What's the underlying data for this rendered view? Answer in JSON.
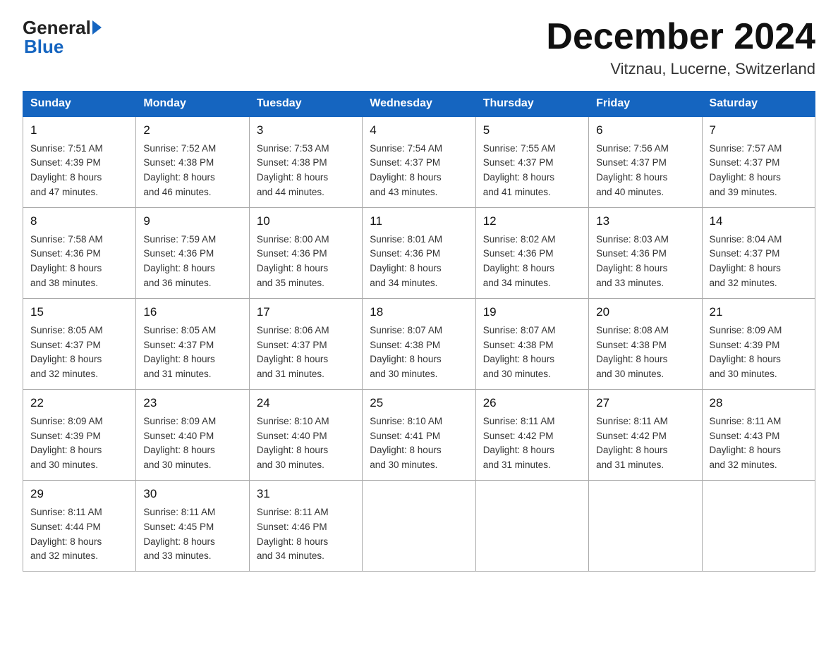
{
  "header": {
    "logo_general": "General",
    "logo_blue": "Blue",
    "month_title": "December 2024",
    "location": "Vitznau, Lucerne, Switzerland"
  },
  "days_of_week": [
    "Sunday",
    "Monday",
    "Tuesday",
    "Wednesday",
    "Thursday",
    "Friday",
    "Saturday"
  ],
  "weeks": [
    [
      {
        "day": "1",
        "sunrise": "7:51 AM",
        "sunset": "4:39 PM",
        "daylight": "8 hours and 47 minutes."
      },
      {
        "day": "2",
        "sunrise": "7:52 AM",
        "sunset": "4:38 PM",
        "daylight": "8 hours and 46 minutes."
      },
      {
        "day": "3",
        "sunrise": "7:53 AM",
        "sunset": "4:38 PM",
        "daylight": "8 hours and 44 minutes."
      },
      {
        "day": "4",
        "sunrise": "7:54 AM",
        "sunset": "4:37 PM",
        "daylight": "8 hours and 43 minutes."
      },
      {
        "day": "5",
        "sunrise": "7:55 AM",
        "sunset": "4:37 PM",
        "daylight": "8 hours and 41 minutes."
      },
      {
        "day": "6",
        "sunrise": "7:56 AM",
        "sunset": "4:37 PM",
        "daylight": "8 hours and 40 minutes."
      },
      {
        "day": "7",
        "sunrise": "7:57 AM",
        "sunset": "4:37 PM",
        "daylight": "8 hours and 39 minutes."
      }
    ],
    [
      {
        "day": "8",
        "sunrise": "7:58 AM",
        "sunset": "4:36 PM",
        "daylight": "8 hours and 38 minutes."
      },
      {
        "day": "9",
        "sunrise": "7:59 AM",
        "sunset": "4:36 PM",
        "daylight": "8 hours and 36 minutes."
      },
      {
        "day": "10",
        "sunrise": "8:00 AM",
        "sunset": "4:36 PM",
        "daylight": "8 hours and 35 minutes."
      },
      {
        "day": "11",
        "sunrise": "8:01 AM",
        "sunset": "4:36 PM",
        "daylight": "8 hours and 34 minutes."
      },
      {
        "day": "12",
        "sunrise": "8:02 AM",
        "sunset": "4:36 PM",
        "daylight": "8 hours and 34 minutes."
      },
      {
        "day": "13",
        "sunrise": "8:03 AM",
        "sunset": "4:36 PM",
        "daylight": "8 hours and 33 minutes."
      },
      {
        "day": "14",
        "sunrise": "8:04 AM",
        "sunset": "4:37 PM",
        "daylight": "8 hours and 32 minutes."
      }
    ],
    [
      {
        "day": "15",
        "sunrise": "8:05 AM",
        "sunset": "4:37 PM",
        "daylight": "8 hours and 32 minutes."
      },
      {
        "day": "16",
        "sunrise": "8:05 AM",
        "sunset": "4:37 PM",
        "daylight": "8 hours and 31 minutes."
      },
      {
        "day": "17",
        "sunrise": "8:06 AM",
        "sunset": "4:37 PM",
        "daylight": "8 hours and 31 minutes."
      },
      {
        "day": "18",
        "sunrise": "8:07 AM",
        "sunset": "4:38 PM",
        "daylight": "8 hours and 30 minutes."
      },
      {
        "day": "19",
        "sunrise": "8:07 AM",
        "sunset": "4:38 PM",
        "daylight": "8 hours and 30 minutes."
      },
      {
        "day": "20",
        "sunrise": "8:08 AM",
        "sunset": "4:38 PM",
        "daylight": "8 hours and 30 minutes."
      },
      {
        "day": "21",
        "sunrise": "8:09 AM",
        "sunset": "4:39 PM",
        "daylight": "8 hours and 30 minutes."
      }
    ],
    [
      {
        "day": "22",
        "sunrise": "8:09 AM",
        "sunset": "4:39 PM",
        "daylight": "8 hours and 30 minutes."
      },
      {
        "day": "23",
        "sunrise": "8:09 AM",
        "sunset": "4:40 PM",
        "daylight": "8 hours and 30 minutes."
      },
      {
        "day": "24",
        "sunrise": "8:10 AM",
        "sunset": "4:40 PM",
        "daylight": "8 hours and 30 minutes."
      },
      {
        "day": "25",
        "sunrise": "8:10 AM",
        "sunset": "4:41 PM",
        "daylight": "8 hours and 30 minutes."
      },
      {
        "day": "26",
        "sunrise": "8:11 AM",
        "sunset": "4:42 PM",
        "daylight": "8 hours and 31 minutes."
      },
      {
        "day": "27",
        "sunrise": "8:11 AM",
        "sunset": "4:42 PM",
        "daylight": "8 hours and 31 minutes."
      },
      {
        "day": "28",
        "sunrise": "8:11 AM",
        "sunset": "4:43 PM",
        "daylight": "8 hours and 32 minutes."
      }
    ],
    [
      {
        "day": "29",
        "sunrise": "8:11 AM",
        "sunset": "4:44 PM",
        "daylight": "8 hours and 32 minutes."
      },
      {
        "day": "30",
        "sunrise": "8:11 AM",
        "sunset": "4:45 PM",
        "daylight": "8 hours and 33 minutes."
      },
      {
        "day": "31",
        "sunrise": "8:11 AM",
        "sunset": "4:46 PM",
        "daylight": "8 hours and 34 minutes."
      },
      null,
      null,
      null,
      null
    ]
  ],
  "labels": {
    "sunrise": "Sunrise:",
    "sunset": "Sunset:",
    "daylight": "Daylight:"
  }
}
